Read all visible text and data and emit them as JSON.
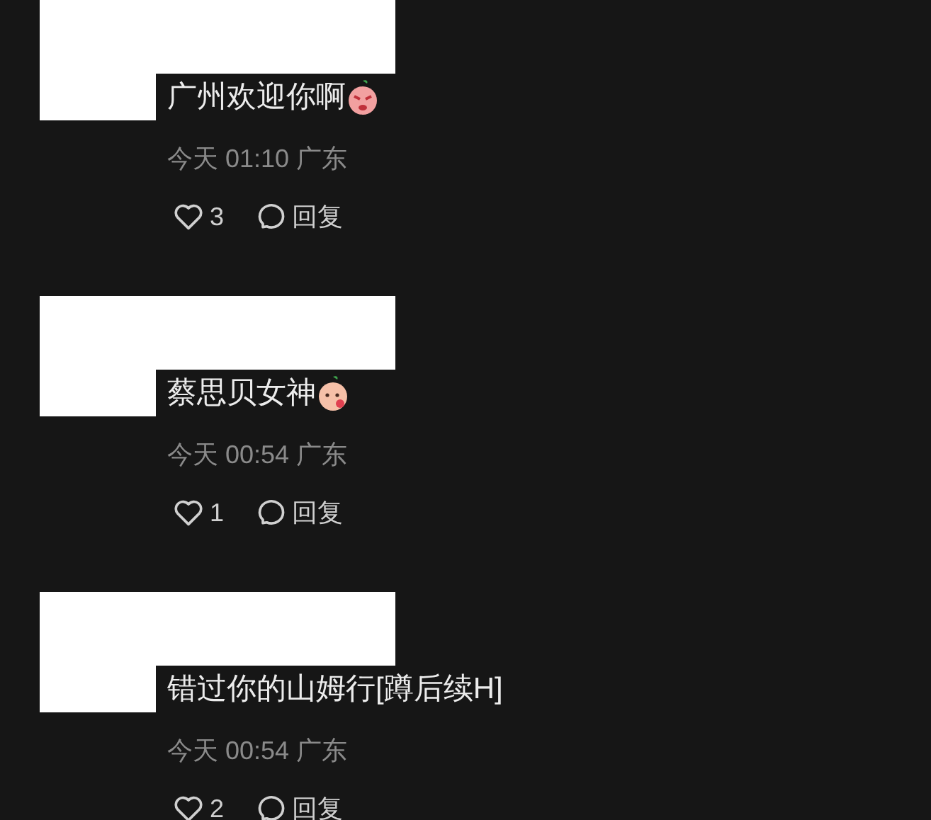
{
  "comments": [
    {
      "kind": "angry",
      "text": "广州欢迎你啊",
      "time": "今天 01:10 广东",
      "likes": "3",
      "reply": "回复"
    },
    {
      "kind": "shy",
      "text": "蔡思贝女神",
      "time": "今天 00:54 广东",
      "likes": "1",
      "reply": "回复"
    },
    {
      "kind": "plain",
      "text": "错过你的山姆行[蹲后续H]",
      "time": "今天 00:54 广东",
      "likes": "2",
      "reply": "回复"
    }
  ]
}
